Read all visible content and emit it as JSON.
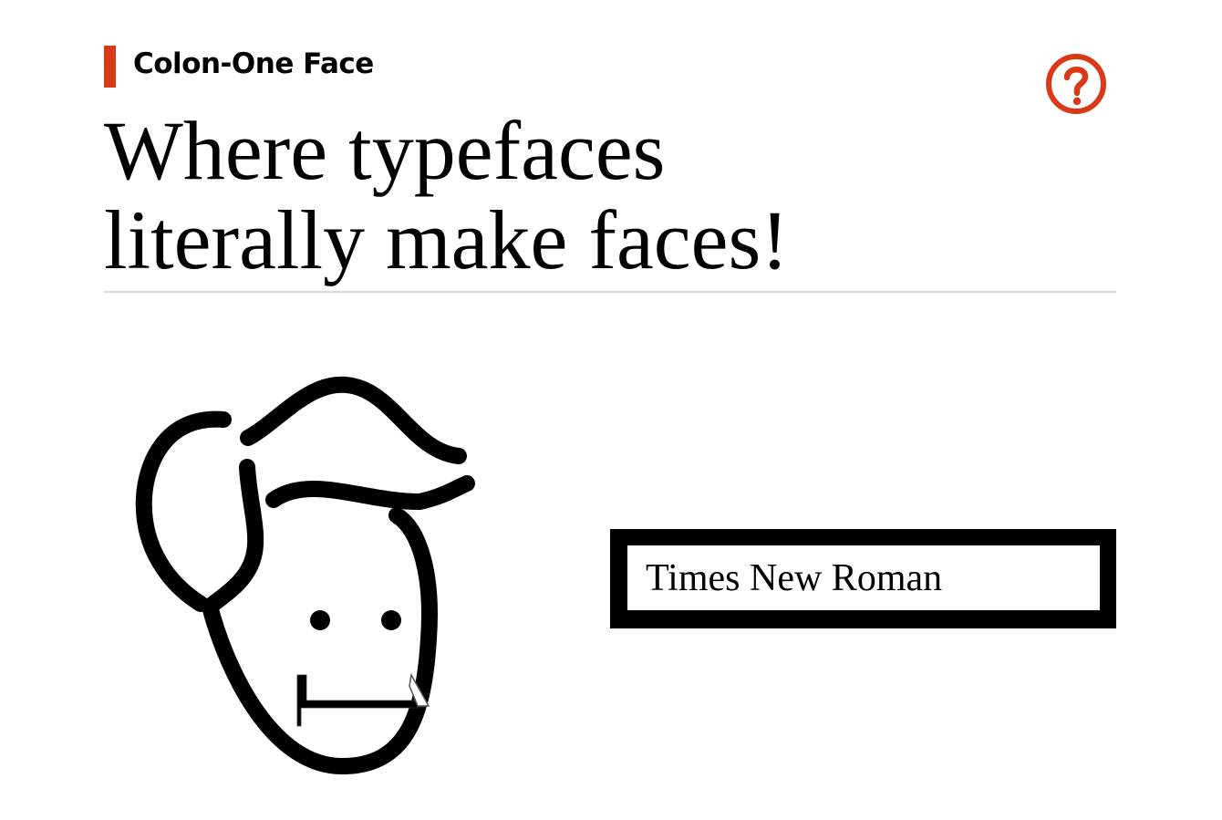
{
  "brand": {
    "name": "Colon-One Face",
    "accent_color": "#d83a18"
  },
  "header": {
    "help_icon": "question-circle-icon",
    "help_icon_color": "#d83a18"
  },
  "headline": {
    "line1": "Where typefaces",
    "line2": "literally make faces!"
  },
  "face": {
    "mouth_glyph": "L"
  },
  "font_input": {
    "value": "Times New Roman"
  }
}
